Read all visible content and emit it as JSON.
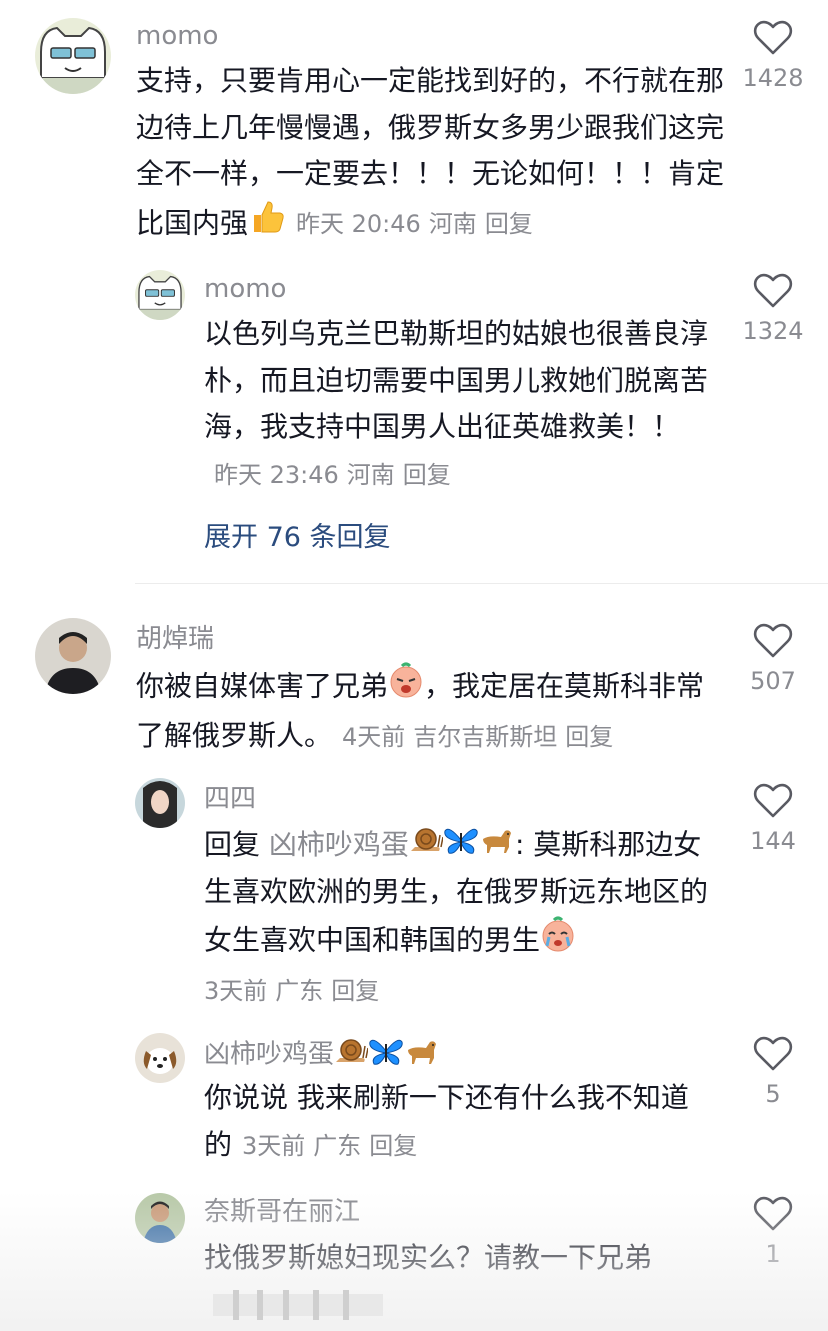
{
  "comments": [
    {
      "name": "momo",
      "text": "支持，只要肯用心一定能找到好的，不行就在那边待上几年慢慢遇，俄罗斯女多男少跟我们这完全不一样，一定要去！！！无论如何！！！肯定比国内强",
      "time": "昨天 20:46",
      "location": "河南",
      "reply_label": "回复",
      "likes": "1428"
    },
    {
      "name": "momo",
      "text": "以色列乌克兰巴勒斯坦的姑娘也很善良淳朴，而且迫切需要中国男儿救她们脱离苦海，我支持中国男人出征英雄救美！！",
      "time": "昨天 23:46",
      "location": "河南",
      "reply_label": "回复",
      "likes": "1324"
    },
    {
      "name": "胡焯瑞",
      "text_a": "你被自媒体害了兄弟",
      "text_b": "，我定居在莫斯科非常了解俄罗斯人。",
      "time": "4天前",
      "location": "吉尔吉斯斯坦",
      "reply_label": "回复",
      "likes": "507"
    },
    {
      "name": "四四",
      "reply_prefix": "回复",
      "reply_to": "凶柿吵鸡蛋",
      "text": "莫斯科那边女生喜欢欧洲的男生，在俄罗斯远东地区的女生喜欢中国和韩国的男生",
      "time": "3天前",
      "location": "广东",
      "reply_label": "回复",
      "likes": "144"
    },
    {
      "name": "凶柿吵鸡蛋",
      "text": "你说说 我来刷新一下还有什么我不知道的",
      "time": "3天前",
      "location": "广东",
      "reply_label": "回复",
      "likes": "5"
    },
    {
      "name": "奈斯哥在丽江",
      "text": "找俄罗斯媳妇现实么？请教一下兄弟",
      "likes": "1"
    }
  ],
  "expand_replies": "展开 76 条回复",
  "colors": {
    "text": "#161823",
    "meta": "#8a8b91",
    "link": "#2b4c7e"
  }
}
